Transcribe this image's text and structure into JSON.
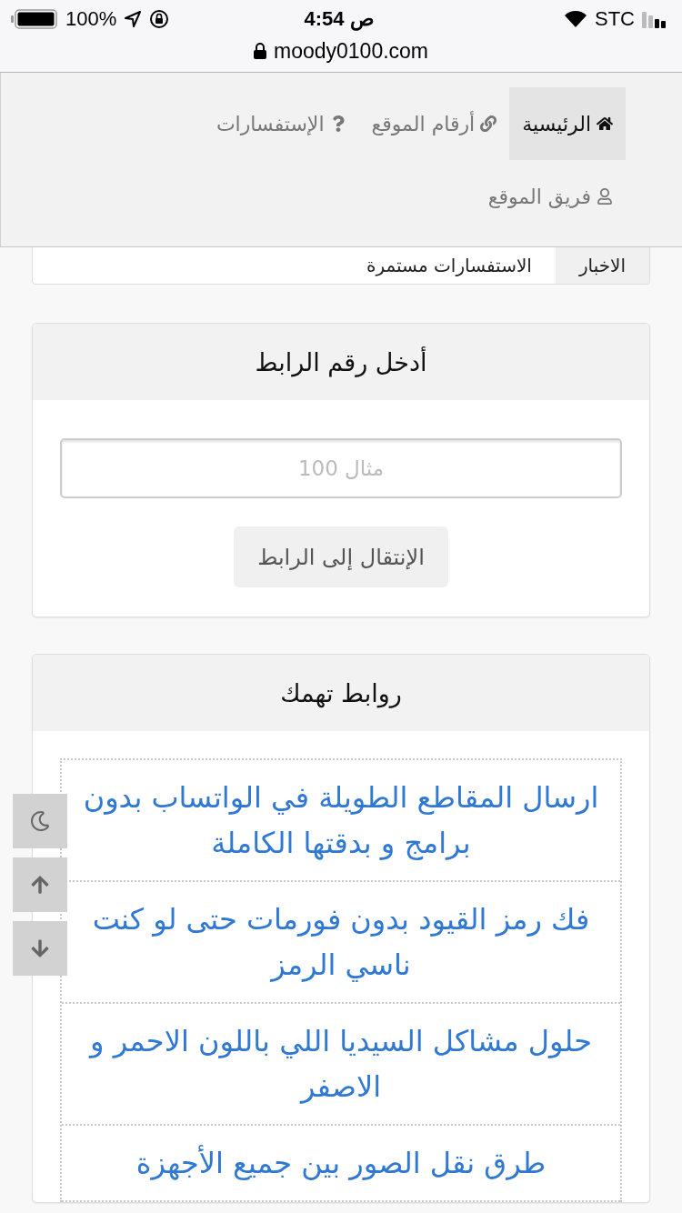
{
  "status_bar": {
    "battery": "100%",
    "time": "4:54 ص",
    "carrier": "STC"
  },
  "address_bar": {
    "url": "moody0100.com"
  },
  "nav": [
    {
      "label": "الرئيسية",
      "selected": true
    },
    {
      "label": "أرقام الموقع",
      "selected": false
    },
    {
      "label": "الإستفسارات",
      "selected": false
    },
    {
      "label": "فريق الموقع",
      "selected": false
    }
  ],
  "ticker": {
    "label": "الاخبار",
    "text": "الاستفسارات مستمرة"
  },
  "link_form": {
    "title": "أدخل رقم الرابط",
    "placeholder": "مثال 100",
    "button": "الإنتقال إلى الرابط"
  },
  "links_card": {
    "title": "روابط تهمك",
    "links": [
      "ارسال المقاطع الطويلة في الواتساب بدون برامج و بدقتها الكاملة",
      "فك رمز القيود بدون فورمات حتى لو كنت ناسي الرمز",
      "حلول مشاكل السيديا اللي باللون الاحمر و الاصفر",
      "طرق نقل الصور بين جميع الأجهزة"
    ]
  },
  "floating_buttons": [
    {
      "kind": "dark-mode"
    },
    {
      "kind": "scroll-up"
    },
    {
      "kind": "scroll-down"
    }
  ]
}
